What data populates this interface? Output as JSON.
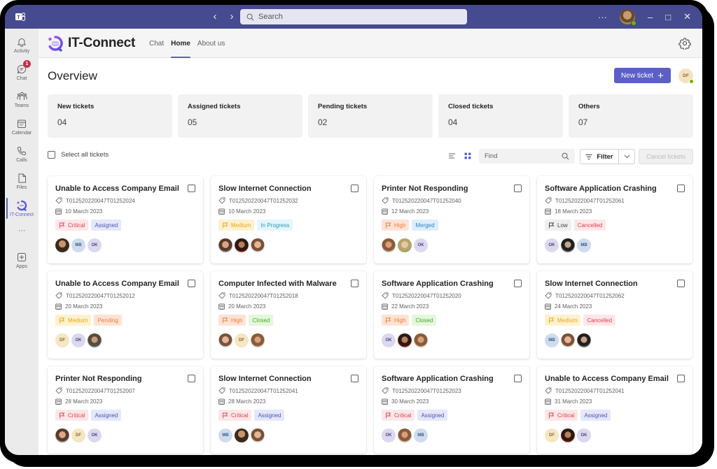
{
  "titlebar": {
    "search_placeholder": "Search",
    "more_label": "···",
    "minimize": "–",
    "maximize": "□",
    "close": "✕"
  },
  "rail": [
    {
      "id": "activity",
      "label": "Activity",
      "icon": "bell-icon"
    },
    {
      "id": "chat",
      "label": "Chat",
      "icon": "chat-icon",
      "badge": "1"
    },
    {
      "id": "teams",
      "label": "Teams",
      "icon": "teams-icon"
    },
    {
      "id": "calendar",
      "label": "Calendar",
      "icon": "calendar-icon"
    },
    {
      "id": "calls",
      "label": "Calls",
      "icon": "phone-icon"
    },
    {
      "id": "files",
      "label": "Files",
      "icon": "file-icon"
    },
    {
      "id": "it-connect",
      "label": "IT-Connect",
      "icon": "it-connect-icon",
      "active": true
    },
    {
      "id": "more",
      "label": "···",
      "icon": "more-icon"
    },
    {
      "id": "apps",
      "label": "Apps",
      "icon": "apps-icon"
    }
  ],
  "app": {
    "name": "IT-Connect",
    "tabs": [
      {
        "label": "Chat",
        "active": false
      },
      {
        "label": "Home",
        "active": true
      },
      {
        "label": "About us",
        "active": false
      }
    ]
  },
  "overview": {
    "title": "Overview",
    "new_ticket_label": "New ticket",
    "user_initials": "DF"
  },
  "stats": [
    {
      "label": "New tickets",
      "value": "04"
    },
    {
      "label": "Assigned tickets",
      "value": "05"
    },
    {
      "label": "Pending tickets",
      "value": "02"
    },
    {
      "label": "Closed tickets",
      "value": "04"
    },
    {
      "label": "Others",
      "value": "07"
    }
  ],
  "toolbar": {
    "select_all_label": "Select all tickets",
    "find_placeholder": "Find",
    "filter_label": "Filter",
    "cancel_label": "Cancel tickets"
  },
  "colors": {
    "brand": "#5b5fc7",
    "titlebar": "#464a8f",
    "priority": {
      "Critical": {
        "bg": "#fde7e9",
        "fg": "#e0404f"
      },
      "Medium": {
        "bg": "#fdf2cf",
        "fg": "#e9a517"
      },
      "High": {
        "bg": "#fde3d6",
        "fg": "#f07c3c"
      },
      "Low": {
        "bg": "#efefef",
        "fg": "#424242"
      }
    },
    "status": {
      "Assigned": {
        "bg": "#e5e7fb",
        "fg": "#4f52b2"
      },
      "In Progress": {
        "bg": "#e3f6fb",
        "fg": "#2a98b5"
      },
      "Merged": {
        "bg": "#ddeffb",
        "fg": "#2f7fc2"
      },
      "Cancelled": {
        "bg": "#fde7e9",
        "fg": "#e0404f"
      },
      "Pending": {
        "bg": "#fde3d6",
        "fg": "#f07c3c"
      },
      "Closed": {
        "bg": "#e4f7dc",
        "fg": "#4aa82c"
      }
    },
    "initials": {
      "MB": {
        "bg": "#cfdcef",
        "fg": "#3b5a8a"
      },
      "OK": {
        "bg": "#dcd8ef",
        "fg": "#4a4580"
      },
      "DF": {
        "bg": "#f5e6c4",
        "fg": "#8a6a2b"
      }
    }
  },
  "tickets": [
    {
      "title": "Unable to Access Company Email",
      "id": "T012520220047T01252024",
      "date": "10 March 2023",
      "priority": "Critical",
      "status": "Assigned",
      "assignees": [
        "photo:p1",
        "MB",
        "OK"
      ]
    },
    {
      "title": "Slow Internet Connection",
      "id": "T012520220047T01252032",
      "date": "10 March 2023",
      "priority": "Medium",
      "status": "In Progress",
      "assignees": [
        "photo:p2",
        "photo:p3",
        "photo:p4"
      ]
    },
    {
      "title": "Printer Not Responding",
      "id": "T012520220047T01252040",
      "date": "12 March 2023",
      "priority": "High",
      "status": "Merged",
      "assignees": [
        "photo:p5",
        "photo:p6",
        "OK"
      ]
    },
    {
      "title": "Software Application Crashing",
      "id": "T012520220047T01252061",
      "date": "18 March 2023",
      "priority": "Low",
      "status": "Cancelled",
      "assignees": [
        "OK",
        "photo:p7",
        "MB"
      ]
    },
    {
      "title": "Unable to Access Company Email",
      "id": "T012520220047T01252012",
      "date": "20 March 2023",
      "priority": "Medium",
      "status": "Pending",
      "assignees": [
        "DF",
        "OK",
        "photo:p8"
      ]
    },
    {
      "title": "Computer Infected with Malware",
      "id": "T012520220047T01252018",
      "date": "20 March 2023",
      "priority": "High",
      "status": "Closed",
      "assignees": [
        "photo:p4",
        "DF",
        "photo:p5"
      ]
    },
    {
      "title": "Software Application Crashing",
      "id": "T012520220047T01252020",
      "date": "22 March 2023",
      "priority": "High",
      "status": "Closed",
      "assignees": [
        "OK",
        "photo:p3",
        "photo:p5"
      ]
    },
    {
      "title": "Slow Internet Connection",
      "id": "T012520220047T01252062",
      "date": "24 March 2023",
      "priority": "Medium",
      "status": "Cancelled",
      "assignees": [
        "MB",
        "photo:p4",
        "photo:p7"
      ]
    },
    {
      "title": "Printer Not Responding",
      "id": "T012520220047T01252007",
      "date": "28 March 2023",
      "priority": "Critical",
      "status": "Assigned",
      "assignees": [
        "photo:p2",
        "DF",
        "OK"
      ]
    },
    {
      "title": "Slow Internet Connection",
      "id": "T012520220047T01252041",
      "date": "28 March 2023",
      "priority": "Critical",
      "status": "Assigned",
      "assignees": [
        "MB",
        "photo:p1",
        "photo:p4"
      ]
    },
    {
      "title": "Software Application Crashing",
      "id": "T012520220047T01252023",
      "date": "30 March 2023",
      "priority": "Critical",
      "status": "Assigned",
      "assignees": [
        "OK",
        "photo:p5",
        "MB"
      ]
    },
    {
      "title": "Unable to Access Company Email",
      "id": "T012520220047T01252041",
      "date": "31 March 2023",
      "priority": "Critical",
      "status": "Assigned",
      "assignees": [
        "DF",
        "photo:p3",
        "OK"
      ]
    }
  ]
}
